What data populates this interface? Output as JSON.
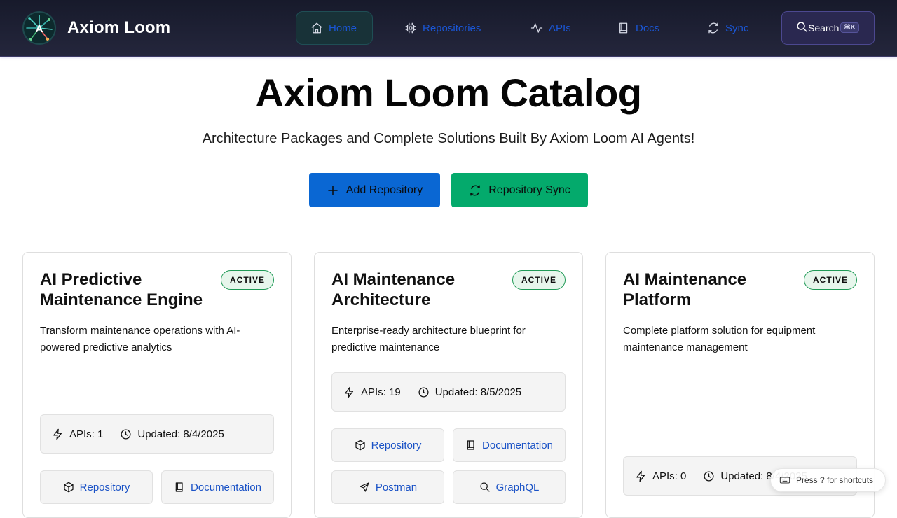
{
  "header": {
    "brand": "Axiom Loom",
    "nav": [
      {
        "label": "Home",
        "icon": "home-icon",
        "active": true
      },
      {
        "label": "Repositories",
        "icon": "chip-icon"
      },
      {
        "label": "APIs",
        "icon": "activity-icon"
      },
      {
        "label": "Docs",
        "icon": "book-icon"
      },
      {
        "label": "Sync",
        "icon": "refresh-icon"
      }
    ],
    "search_label": "Search",
    "search_shortcut": "⌘K"
  },
  "hero": {
    "title": "Axiom Loom Catalog",
    "subtitle": "Architecture Packages and Complete Solutions Built By Axiom Loom AI Agents!",
    "add_repository": "Add Repository",
    "repository_sync": "Repository Sync"
  },
  "cards": [
    {
      "title": "AI Predictive Maintenance Engine",
      "status": "ACTIVE",
      "description": "Transform maintenance operations with AI-powered predictive analytics",
      "apis": "APIs: 1",
      "updated": "Updated: 8/4/2025",
      "links": [
        "Repository",
        "Documentation"
      ]
    },
    {
      "title": "AI Maintenance Architecture",
      "status": "ACTIVE",
      "description": "Enterprise-ready architecture blueprint for predictive maintenance",
      "apis": "APIs: 19",
      "updated": "Updated: 8/5/2025",
      "links": [
        "Repository",
        "Documentation",
        "Postman",
        "GraphQL"
      ]
    },
    {
      "title": "AI Maintenance Platform",
      "status": "ACTIVE",
      "description": "Complete platform solution for equipment maintenance management",
      "apis": "APIs: 0",
      "updated": "Updated: 8/4/2025",
      "links": []
    }
  ],
  "toast": "Press ? for shortcuts",
  "colors": {
    "accent_blue": "#0a67d3",
    "accent_green": "#04aa6c",
    "link": "#1a52c6",
    "header_bg": "#1c1e31"
  }
}
